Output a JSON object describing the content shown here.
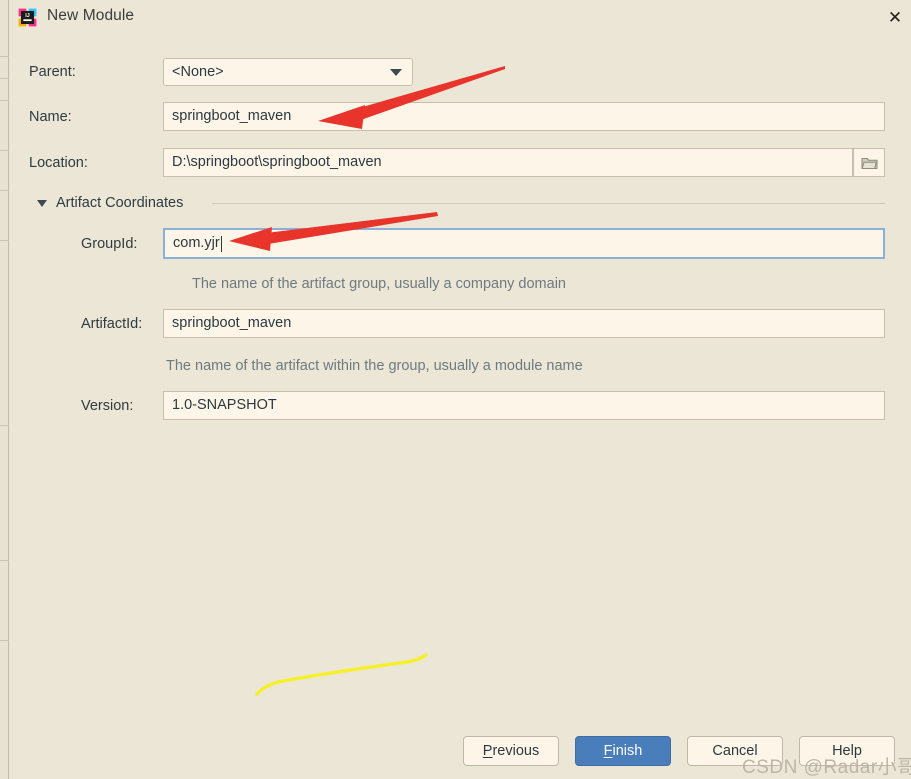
{
  "window": {
    "title": "New Module",
    "app_icon": "intellij-idea-icon",
    "close_label": "✕"
  },
  "colors": {
    "background": "#ebe6d6",
    "field_background": "#fdf6e8",
    "field_border": "#c4bfae",
    "focus_border": "#8bb0d6",
    "primary_button": "#4a7ebb",
    "text": "#2c3940",
    "hint_text": "#6e7a80",
    "annotation_arrow": "#e8342a",
    "annotation_stroke": "#f5f027"
  },
  "form": {
    "parent": {
      "label": "Parent:",
      "value": "<None>",
      "icon": "chevron-down-icon"
    },
    "name": {
      "label": "Name:",
      "value": "springboot_maven"
    },
    "location": {
      "label": "Location:",
      "value": "D:\\springboot\\springboot_maven",
      "browse_icon": "folder-icon"
    }
  },
  "artifact_section": {
    "label": "Artifact Coordinates",
    "expanded": true,
    "toggle_icon": "triangle-down-icon",
    "group_id": {
      "label": "GroupId:",
      "value": "com.yjr",
      "focused": true,
      "hint": "The name of the artifact group, usually a company domain"
    },
    "artifact_id": {
      "label": "ArtifactId:",
      "value": "springboot_maven",
      "hint": "The name of the artifact within the group, usually a module name"
    },
    "version": {
      "label": "Version:",
      "value": "1.0-SNAPSHOT"
    }
  },
  "buttons": {
    "previous": {
      "label": "Previous",
      "mnemonic": "P"
    },
    "finish": {
      "label": "Finish",
      "mnemonic": "F",
      "primary": true
    },
    "cancel": {
      "label": "Cancel"
    },
    "help": {
      "label": "Help"
    }
  },
  "watermark": {
    "text": "CSDN @Radar小哥"
  },
  "annotations": [
    {
      "type": "arrow",
      "name": "arrow-pointing-to-name-field",
      "color": "#e8342a"
    },
    {
      "type": "arrow",
      "name": "arrow-pointing-to-groupid-field",
      "color": "#e8342a"
    },
    {
      "type": "stroke",
      "name": "yellow-highlight-stroke",
      "color": "#f5f027"
    }
  ]
}
